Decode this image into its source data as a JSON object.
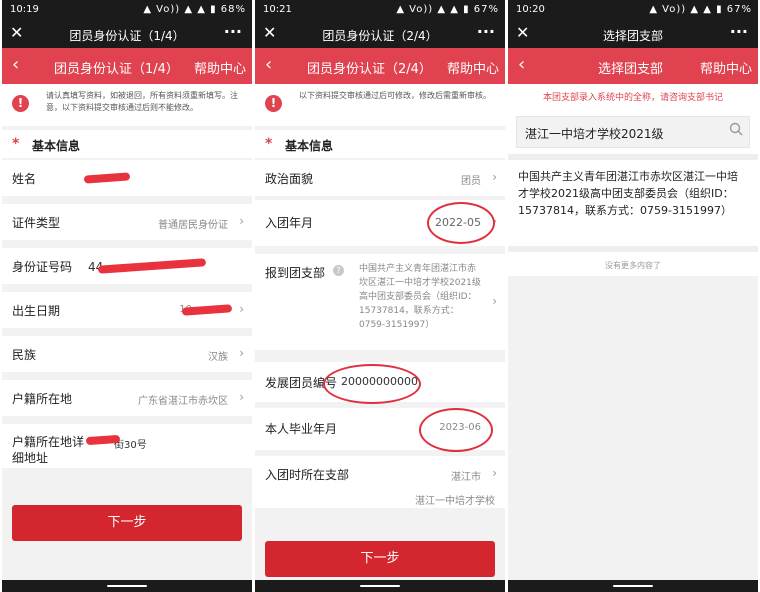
{
  "panel1": {
    "status_time": "10:19",
    "status_icons": "▲ Vo)) ▲ ▲ ▮ 68%",
    "wx_title": "团员身份认证（1/4）",
    "page_title": "团员身份认证（1/4）",
    "help_label": "帮助中心",
    "notice": "请认真填写资料，如被退回，所有资料须重新填写。注意，以下资料提交审核通过后则不能修改。",
    "section_title": "基本信息",
    "rows": [
      {
        "label": "姓名",
        "value": ""
      },
      {
        "label": "证件类型",
        "value": "普通居民身份证"
      },
      {
        "label": "身份证号码",
        "value": "44"
      },
      {
        "label": "出生日期",
        "value": "10"
      },
      {
        "label": "民族",
        "value": "汉族"
      },
      {
        "label": "户籍所在地",
        "value": "广东省湛江市赤坎区"
      },
      {
        "label": "户籍所在地详细地址",
        "value": "街30号"
      }
    ],
    "next_label": "下一步"
  },
  "panel2": {
    "status_time": "10:21",
    "status_icons": "▲ Vo)) ▲ ▲ ▮ 67%",
    "wx_title": "团员身份认证（2/4）",
    "page_title": "团员身份认证（2/4）",
    "help_label": "帮助中心",
    "notice": "以下资料提交审核通过后可修改，修改后需重新审核。",
    "section_title": "基本信息",
    "rows": [
      {
        "label": "政治面貌",
        "value": "团员"
      },
      {
        "label": "入团年月",
        "value": "2022-05"
      },
      {
        "label": "报到团支部",
        "value": "中国共产主义青年团湛江市赤坎区湛江一中培才学校2021级高中团支部委员会（组织ID：15737814，联系方式：0759-3151997）"
      },
      {
        "label": "发展团员编号",
        "value": "20000000000"
      },
      {
        "label": "本人毕业年月",
        "value": "2023-06"
      },
      {
        "label": "入团时所在支部",
        "value": "湛江市"
      }
    ],
    "branch_school": "湛江一中培才学校",
    "next_label": "下一步"
  },
  "panel3": {
    "status_time": "10:20",
    "status_icons": "▲ Vo)) ▲ ▲ ▮ 67%",
    "wx_title": "选择团支部",
    "page_title": "选择团支部",
    "help_label": "帮助中心",
    "hint": "本团支部录入系统中的全称，请咨询支部书记",
    "search_value": "湛江一中培才学校2021级",
    "result": "中国共产主义青年团湛江市赤坎区湛江一中培才学校2021级高中团支部委员会（组织ID：15737814，联系方式：0759-3151997）",
    "no_more": "没有更多内容了"
  },
  "colors": {
    "accent": "#e0434f",
    "button": "#d4262f"
  }
}
